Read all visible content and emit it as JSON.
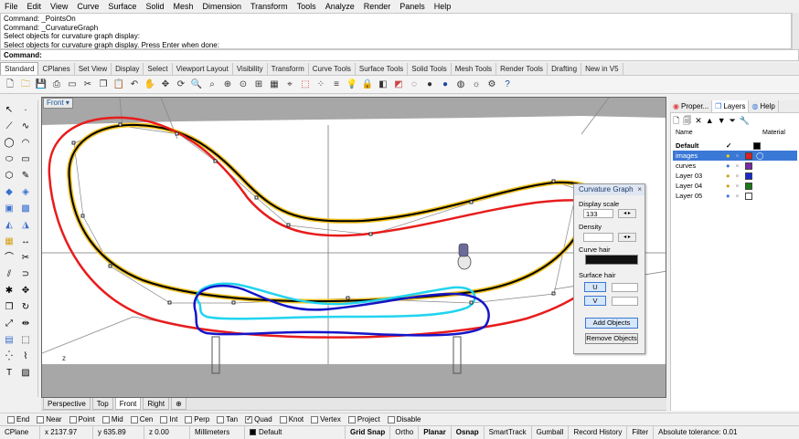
{
  "menu": [
    "File",
    "Edit",
    "View",
    "Curve",
    "Surface",
    "Solid",
    "Mesh",
    "Dimension",
    "Transform",
    "Tools",
    "Analyze",
    "Render",
    "Panels",
    "Help"
  ],
  "command_history": [
    "Command: _PointsOn",
    "Command: _CurvatureGraph",
    "Select objects for curvature graph display:",
    "Select objects for curvature graph display. Press Enter when done:"
  ],
  "command_prompt": "Command:",
  "toolbar_tabs": [
    "Standard",
    "CPlanes",
    "Set View",
    "Display",
    "Select",
    "Viewport Layout",
    "Visibility",
    "Transform",
    "Curve Tools",
    "Surface Tools",
    "Solid Tools",
    "Mesh Tools",
    "Render Tools",
    "Drafting",
    "New in V5"
  ],
  "viewport": {
    "name": "Front",
    "axis_label": "z"
  },
  "viewport_tabs": [
    "Perspective",
    "Top",
    "Front",
    "Right"
  ],
  "panel_tabs": [
    "Proper...",
    "Layers",
    "Help"
  ],
  "layers": {
    "columns": {
      "name": "Name",
      "material": "Material"
    },
    "rows": [
      {
        "name": "Default",
        "color": "#000000"
      },
      {
        "name": "images",
        "color": "#e02020"
      },
      {
        "name": "curves",
        "color": "#7a2aa8"
      },
      {
        "name": "Layer 03",
        "color": "#1a2ad0"
      },
      {
        "name": "Layer 04",
        "color": "#1a7a1a"
      },
      {
        "name": "Layer 05",
        "color": "#ffffff"
      }
    ]
  },
  "curvature_dialog": {
    "title": "Curvature Graph",
    "display_scale_label": "Display scale",
    "display_scale_value": "133",
    "density_label": "Density",
    "curve_hair_label": "Curve hair",
    "surface_hair_label": "Surface hair",
    "u_label": "U",
    "v_label": "V",
    "add_objects": "Add Objects",
    "remove_objects": "Remove Objects"
  },
  "osnaps": [
    {
      "label": "End",
      "on": false
    },
    {
      "label": "Near",
      "on": false
    },
    {
      "label": "Point",
      "on": false
    },
    {
      "label": "Mid",
      "on": false
    },
    {
      "label": "Cen",
      "on": false
    },
    {
      "label": "Int",
      "on": false
    },
    {
      "label": "Perp",
      "on": false
    },
    {
      "label": "Tan",
      "on": false
    },
    {
      "label": "Quad",
      "on": true
    },
    {
      "label": "Knot",
      "on": false
    },
    {
      "label": "Vertex",
      "on": false
    },
    {
      "label": "Project",
      "on": false
    },
    {
      "label": "Disable",
      "on": false
    }
  ],
  "status": {
    "cplane": "CPlane",
    "x": "x 2137.97",
    "y": "y 635.89",
    "z": "z 0.00",
    "units": "Millimeters",
    "layer": "Default",
    "grid_snap": "Grid Snap",
    "ortho": "Ortho",
    "planar": "Planar",
    "osnap": "Osnap",
    "smarttrack": "SmartTrack",
    "gumball": "Gumball",
    "record_history": "Record History",
    "filter": "Filter",
    "tolerance": "Absolute tolerance: 0.01"
  },
  "colors": {
    "curve_black": "#000000",
    "curve_red": "#e81c1c",
    "curve_yellow": "#f0c020",
    "curve_cyan": "#21d4ef",
    "curve_blue": "#1515c8",
    "viewport_bg": "#a7a7a7"
  }
}
